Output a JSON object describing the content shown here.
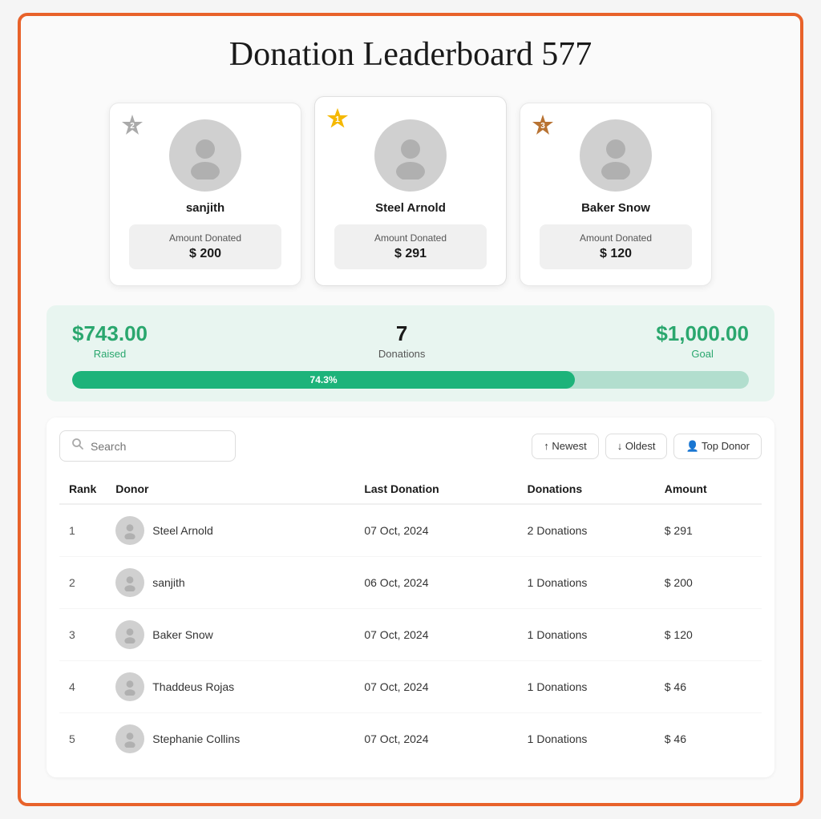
{
  "page": {
    "title": "Donation Leaderboard 577",
    "outer_border_color": "#e8622a"
  },
  "podium": [
    {
      "rank": 2,
      "badge_type": "silver",
      "badge_label": "2",
      "name": "sanjith",
      "amount_label": "Amount Donated",
      "amount": "$ 200",
      "card_order": "second"
    },
    {
      "rank": 1,
      "badge_type": "gold",
      "badge_label": "1",
      "name": "Steel Arnold",
      "amount_label": "Amount Donated",
      "amount": "$ 291",
      "card_order": "first"
    },
    {
      "rank": 3,
      "badge_type": "bronze",
      "badge_label": "3",
      "name": "Baker Snow",
      "amount_label": "Amount Donated",
      "amount": "$ 120",
      "card_order": "third"
    }
  ],
  "stats": {
    "raised_label": "Raised",
    "raised_value": "$743.00",
    "donations_label": "Donations",
    "donations_value": "7",
    "goal_label": "Goal",
    "goal_value": "$1,000.00",
    "progress_pct": 74.3,
    "progress_label": "74.3%"
  },
  "table": {
    "search_placeholder": "Search",
    "filters": [
      {
        "label": "↑ Newest",
        "icon": "newest-icon"
      },
      {
        "label": "↓ Oldest",
        "icon": "oldest-icon"
      },
      {
        "label": "👤 Top Donor",
        "icon": "top-donor-icon"
      }
    ],
    "columns": [
      "Rank",
      "Donor",
      "Last Donation",
      "Donations",
      "Amount"
    ],
    "rows": [
      {
        "rank": 1,
        "name": "Steel Arnold",
        "last_donation": "07 Oct, 2024",
        "donations": "2 Donations",
        "amount": "$ 291"
      },
      {
        "rank": 2,
        "name": "sanjith",
        "last_donation": "06 Oct, 2024",
        "donations": "1 Donations",
        "amount": "$ 200"
      },
      {
        "rank": 3,
        "name": "Baker Snow",
        "last_donation": "07 Oct, 2024",
        "donations": "1 Donations",
        "amount": "$ 120"
      },
      {
        "rank": 4,
        "name": "Thaddeus Rojas",
        "last_donation": "07 Oct, 2024",
        "donations": "1 Donations",
        "amount": "$ 46"
      },
      {
        "rank": 5,
        "name": "Stephanie Collins",
        "last_donation": "07 Oct, 2024",
        "donations": "1 Donations",
        "amount": "$ 46"
      }
    ]
  }
}
